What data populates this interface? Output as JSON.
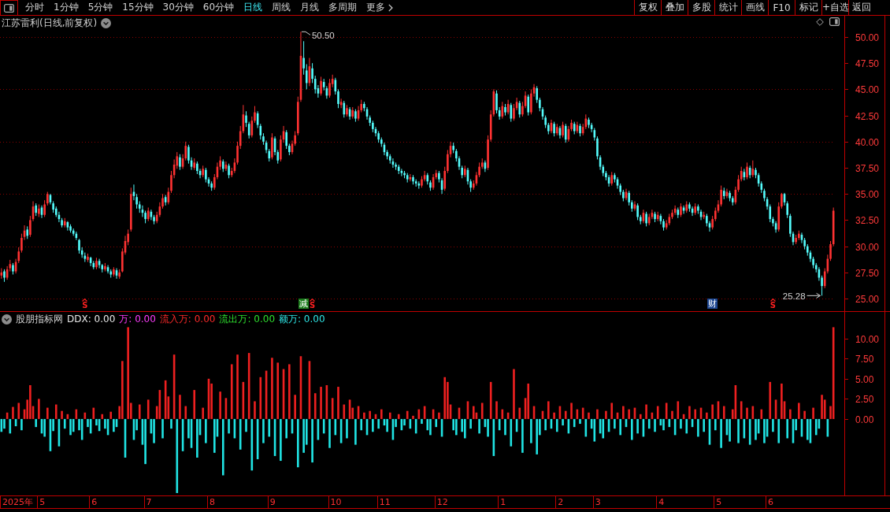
{
  "toolbar": {
    "periods": [
      {
        "label": "分时",
        "selected": false
      },
      {
        "label": "1分钟",
        "selected": false
      },
      {
        "label": "5分钟",
        "selected": false
      },
      {
        "label": "15分钟",
        "selected": false
      },
      {
        "label": "30分钟",
        "selected": false
      },
      {
        "label": "60分钟",
        "selected": false
      },
      {
        "label": "日线",
        "selected": true
      },
      {
        "label": "周线",
        "selected": false
      },
      {
        "label": "月线",
        "selected": false
      },
      {
        "label": "多周期",
        "selected": false
      }
    ],
    "more": "更多",
    "actions": [
      "复权",
      "叠加",
      "多股",
      "统计",
      "画线",
      "F10",
      "标记",
      "+自选",
      "返回"
    ]
  },
  "price_pane": {
    "title": "江苏雷利(日线,前复权)",
    "chart_data": [
      {
        "type": "candlestick",
        "ylim": [
          23.8,
          52.03
        ],
        "yticks": [
          {
            "value": 25,
            "label": "25.00"
          },
          {
            "value": 27.5,
            "label": "27.50"
          },
          {
            "value": 30,
            "label": "30.00"
          },
          {
            "value": 32.5,
            "label": "32.50"
          },
          {
            "value": 35,
            "label": "35.00"
          },
          {
            "value": 37.5,
            "label": "37.50"
          },
          {
            "value": 40,
            "label": "40.00"
          },
          {
            "value": 42.5,
            "label": "42.50"
          },
          {
            "value": 45,
            "label": "45.00"
          },
          {
            "value": 47.5,
            "label": "47.50"
          },
          {
            "value": 50,
            "label": "50.00"
          }
        ],
        "grid": true,
        "annotations": [
          "50.50",
          "25.28"
        ],
        "ohlc": [
          [
            27.2,
            27.9,
            26.9,
            27.5
          ],
          [
            27.6,
            27.8,
            26.6,
            27.0
          ],
          [
            27.0,
            28.1,
            26.8,
            27.8
          ],
          [
            27.9,
            28.7,
            27.6,
            28.3
          ],
          [
            28.2,
            28.4,
            27.3,
            27.6
          ],
          [
            27.6,
            28.8,
            27.4,
            28.5
          ],
          [
            28.6,
            29.9,
            28.4,
            29.5
          ],
          [
            29.6,
            31.2,
            29.4,
            30.8
          ],
          [
            30.9,
            32.0,
            30.6,
            31.5
          ],
          [
            31.6,
            31.9,
            30.7,
            31.0
          ],
          [
            31.1,
            32.9,
            30.9,
            32.5
          ],
          [
            32.6,
            34.3,
            32.4,
            33.8
          ],
          [
            33.9,
            34.1,
            32.9,
            33.2
          ],
          [
            33.1,
            34.0,
            32.8,
            33.6
          ],
          [
            33.7,
            33.9,
            32.7,
            33.0
          ],
          [
            33.0,
            34.4,
            32.8,
            34.0
          ],
          [
            34.1,
            35.2,
            33.9,
            35.0
          ],
          [
            34.9,
            35.0,
            34.0,
            34.2
          ],
          [
            34.1,
            34.3,
            33.2,
            33.5
          ],
          [
            33.6,
            33.8,
            32.8,
            33.0
          ],
          [
            33.0,
            33.3,
            32.3,
            32.6
          ],
          [
            32.5,
            32.7,
            31.8,
            32.0
          ],
          [
            32.0,
            32.7,
            31.8,
            32.4
          ],
          [
            32.3,
            32.4,
            31.5,
            31.8
          ],
          [
            31.9,
            32.1,
            31.3,
            31.5
          ],
          [
            31.5,
            31.7,
            31.0,
            31.2
          ],
          [
            31.2,
            31.4,
            30.6,
            30.8
          ],
          [
            30.6,
            30.7,
            29.3,
            29.6
          ],
          [
            29.6,
            29.9,
            28.9,
            29.2
          ],
          [
            29.1,
            29.4,
            28.5,
            28.8
          ],
          [
            28.7,
            29.3,
            28.5,
            29.0
          ],
          [
            28.9,
            29.0,
            28.1,
            28.4
          ],
          [
            28.4,
            28.6,
            27.8,
            28.0
          ],
          [
            28.0,
            28.9,
            27.8,
            28.6
          ],
          [
            28.6,
            28.8,
            27.9,
            28.2
          ],
          [
            28.2,
            28.3,
            27.5,
            27.8
          ],
          [
            27.8,
            28.4,
            27.6,
            28.1
          ],
          [
            28.0,
            28.2,
            27.4,
            27.6
          ],
          [
            27.6,
            27.8,
            27.0,
            27.3
          ],
          [
            27.3,
            28.0,
            27.1,
            27.8
          ],
          [
            27.7,
            27.9,
            26.9,
            27.2
          ],
          [
            27.1,
            27.8,
            26.9,
            27.5
          ],
          [
            27.6,
            29.8,
            27.5,
            29.5
          ],
          [
            29.4,
            31.0,
            29.2,
            30.5
          ],
          [
            30.4,
            31.6,
            30.1,
            31.2
          ],
          [
            31.6,
            35.6,
            31.4,
            35.0
          ],
          [
            35.2,
            35.9,
            34.4,
            34.8
          ],
          [
            34.7,
            35.0,
            33.6,
            34.0
          ],
          [
            34.0,
            34.3,
            33.2,
            33.6
          ],
          [
            33.5,
            33.9,
            32.8,
            33.2
          ],
          [
            33.2,
            33.4,
            32.2,
            32.6
          ],
          [
            32.6,
            33.7,
            32.4,
            33.4
          ],
          [
            33.3,
            33.5,
            32.5,
            32.8
          ],
          [
            32.8,
            33.0,
            32.1,
            32.4
          ],
          [
            32.4,
            33.3,
            32.2,
            33.0
          ],
          [
            33.0,
            34.2,
            32.8,
            33.8
          ],
          [
            33.8,
            35.0,
            33.6,
            34.6
          ],
          [
            34.7,
            34.9,
            33.9,
            34.2
          ],
          [
            34.2,
            35.6,
            34.0,
            35.2
          ],
          [
            35.3,
            37.2,
            35.1,
            36.8
          ],
          [
            36.8,
            38.3,
            36.5,
            37.8
          ],
          [
            37.7,
            39.0,
            37.4,
            38.6
          ],
          [
            38.5,
            38.8,
            37.3,
            37.6
          ],
          [
            37.6,
            38.8,
            37.4,
            38.4
          ],
          [
            38.4,
            40.0,
            38.2,
            39.6
          ],
          [
            39.5,
            39.7,
            37.9,
            38.2
          ],
          [
            38.2,
            38.5,
            37.3,
            37.6
          ],
          [
            37.5,
            38.4,
            37.3,
            38.0
          ],
          [
            37.9,
            38.1,
            36.9,
            37.2
          ],
          [
            37.2,
            37.4,
            36.5,
            36.8
          ],
          [
            36.8,
            37.7,
            36.6,
            37.4
          ],
          [
            37.3,
            37.5,
            36.1,
            36.4
          ],
          [
            36.4,
            36.6,
            35.7,
            36.0
          ],
          [
            36.0,
            36.2,
            35.3,
            35.6
          ],
          [
            35.6,
            36.9,
            35.4,
            36.6
          ],
          [
            36.6,
            38.0,
            36.4,
            37.6
          ],
          [
            37.6,
            38.6,
            37.3,
            38.2
          ],
          [
            38.1,
            38.3,
            37.1,
            37.4
          ],
          [
            37.4,
            38.1,
            37.2,
            37.8
          ],
          [
            37.7,
            37.9,
            36.5,
            36.8
          ],
          [
            36.8,
            37.5,
            36.6,
            37.2
          ],
          [
            37.2,
            38.4,
            37.0,
            38.0
          ],
          [
            38.0,
            40.0,
            37.8,
            39.6
          ],
          [
            39.6,
            41.5,
            39.3,
            41.0
          ],
          [
            41.0,
            43.5,
            40.8,
            42.6
          ],
          [
            42.5,
            42.9,
            41.4,
            41.8
          ],
          [
            41.7,
            41.9,
            40.3,
            40.6
          ],
          [
            40.6,
            42.4,
            40.4,
            42.0
          ],
          [
            42.0,
            43.4,
            41.8,
            42.8
          ],
          [
            42.7,
            42.9,
            41.3,
            41.6
          ],
          [
            41.5,
            41.7,
            40.2,
            40.6
          ],
          [
            40.5,
            40.8,
            39.7,
            40.0
          ],
          [
            39.9,
            40.1,
            38.9,
            39.2
          ],
          [
            39.1,
            39.3,
            38.1,
            38.4
          ],
          [
            38.5,
            40.8,
            38.3,
            40.4
          ],
          [
            40.3,
            40.5,
            38.7,
            39.0
          ],
          [
            39.0,
            39.2,
            37.9,
            38.2
          ],
          [
            38.3,
            40.6,
            38.1,
            40.2
          ],
          [
            40.2,
            41.5,
            39.9,
            41.0
          ],
          [
            40.9,
            41.1,
            39.3,
            39.6
          ],
          [
            39.6,
            39.8,
            38.7,
            39.0
          ],
          [
            39.0,
            40.1,
            38.8,
            39.8
          ],
          [
            39.8,
            41.0,
            39.6,
            40.6
          ],
          [
            40.8,
            44.3,
            40.6,
            43.8
          ],
          [
            44.0,
            50.5,
            43.8,
            48.2
          ],
          [
            48.0,
            49.6,
            46.4,
            47.0
          ],
          [
            46.8,
            47.4,
            45.0,
            45.6
          ],
          [
            45.6,
            48.0,
            45.3,
            47.2
          ],
          [
            47.0,
            47.5,
            45.6,
            46.0
          ],
          [
            46.0,
            46.3,
            44.6,
            45.0
          ],
          [
            45.1,
            45.4,
            44.2,
            44.6
          ],
          [
            44.6,
            46.2,
            44.4,
            45.8
          ],
          [
            45.7,
            46.0,
            44.9,
            45.2
          ],
          [
            45.1,
            45.3,
            44.1,
            44.4
          ],
          [
            44.4,
            46.0,
            44.2,
            45.6
          ],
          [
            45.5,
            46.4,
            45.2,
            46.0
          ],
          [
            45.9,
            46.1,
            44.5,
            44.8
          ],
          [
            44.8,
            45.0,
            43.2,
            43.6
          ],
          [
            43.5,
            44.1,
            43.2,
            43.8
          ],
          [
            43.7,
            43.9,
            42.3,
            42.6
          ],
          [
            42.6,
            43.5,
            42.4,
            43.2
          ],
          [
            43.1,
            43.3,
            42.1,
            42.4
          ],
          [
            42.4,
            43.3,
            42.2,
            43.0
          ],
          [
            42.9,
            43.1,
            41.9,
            42.2
          ],
          [
            42.2,
            43.4,
            42.0,
            43.0
          ],
          [
            43.0,
            44.0,
            42.8,
            43.6
          ],
          [
            43.6,
            43.8,
            42.9,
            43.2
          ],
          [
            43.1,
            43.3,
            42.1,
            42.4
          ],
          [
            42.3,
            42.5,
            41.5,
            41.8
          ],
          [
            41.8,
            42.0,
            40.9,
            41.2
          ],
          [
            41.2,
            41.4,
            40.5,
            40.8
          ],
          [
            40.8,
            41.0,
            39.9,
            40.2
          ],
          [
            40.2,
            40.4,
            39.5,
            39.8
          ],
          [
            39.7,
            39.9,
            38.7,
            39.0
          ],
          [
            39.0,
            39.2,
            38.3,
            38.6
          ],
          [
            38.6,
            38.8,
            37.9,
            38.2
          ],
          [
            38.1,
            38.4,
            37.5,
            37.8
          ],
          [
            37.8,
            38.0,
            37.3,
            37.6
          ],
          [
            37.6,
            37.8,
            36.9,
            37.2
          ],
          [
            37.2,
            37.4,
            36.7,
            37.0
          ],
          [
            37.0,
            37.2,
            36.5,
            36.8
          ],
          [
            36.8,
            37.0,
            36.1,
            36.4
          ],
          [
            36.4,
            36.9,
            36.2,
            36.6
          ],
          [
            36.6,
            36.8,
            35.9,
            36.2
          ],
          [
            36.2,
            36.4,
            35.7,
            36.0
          ],
          [
            36.0,
            36.2,
            35.5,
            35.8
          ],
          [
            35.8,
            36.7,
            35.6,
            36.4
          ],
          [
            36.4,
            37.2,
            36.2,
            36.8
          ],
          [
            36.8,
            37.0,
            35.9,
            36.2
          ],
          [
            36.1,
            36.3,
            35.3,
            35.6
          ],
          [
            35.6,
            36.9,
            35.4,
            36.6
          ],
          [
            36.6,
            37.3,
            36.4,
            37.0
          ],
          [
            37.0,
            37.2,
            36.1,
            36.4
          ],
          [
            36.3,
            36.5,
            35.0,
            35.4
          ],
          [
            35.5,
            37.6,
            35.3,
            37.2
          ],
          [
            37.2,
            39.2,
            37.0,
            38.8
          ],
          [
            38.8,
            40.0,
            38.5,
            39.6
          ],
          [
            39.6,
            39.9,
            38.9,
            39.2
          ],
          [
            39.1,
            39.3,
            38.1,
            38.4
          ],
          [
            38.4,
            38.6,
            37.3,
            37.6
          ],
          [
            37.5,
            37.7,
            36.5,
            36.8
          ],
          [
            36.8,
            37.7,
            36.6,
            37.4
          ],
          [
            37.3,
            37.5,
            35.9,
            36.2
          ],
          [
            36.2,
            36.4,
            35.2,
            35.6
          ],
          [
            35.6,
            36.3,
            35.4,
            36.0
          ],
          [
            36.0,
            37.1,
            35.8,
            36.8
          ],
          [
            36.8,
            38.0,
            36.6,
            37.6
          ],
          [
            37.6,
            38.4,
            37.4,
            38.0
          ],
          [
            38.0,
            38.2,
            37.1,
            37.4
          ],
          [
            37.5,
            40.6,
            37.3,
            40.2
          ],
          [
            40.2,
            43.0,
            40.0,
            42.6
          ],
          [
            42.6,
            45.0,
            42.4,
            44.8
          ],
          [
            44.6,
            44.9,
            42.7,
            43.0
          ],
          [
            43.0,
            43.3,
            42.1,
            42.4
          ],
          [
            42.4,
            43.8,
            42.2,
            43.4
          ],
          [
            43.3,
            43.6,
            42.5,
            42.8
          ],
          [
            42.8,
            44.0,
            42.6,
            43.6
          ],
          [
            43.5,
            43.7,
            41.9,
            42.2
          ],
          [
            42.2,
            43.6,
            42.0,
            43.2
          ],
          [
            43.2,
            44.2,
            43.0,
            43.8
          ],
          [
            43.7,
            43.9,
            42.3,
            42.6
          ],
          [
            42.6,
            43.8,
            42.4,
            43.4
          ],
          [
            43.4,
            44.8,
            43.2,
            44.4
          ],
          [
            44.3,
            44.5,
            42.5,
            42.8
          ],
          [
            42.8,
            45.0,
            42.6,
            44.6
          ],
          [
            44.6,
            45.5,
            44.3,
            45.2
          ],
          [
            45.1,
            45.3,
            43.7,
            44.0
          ],
          [
            44.0,
            44.2,
            42.9,
            43.2
          ],
          [
            43.1,
            43.3,
            42.1,
            42.4
          ],
          [
            42.3,
            42.5,
            41.3,
            41.6
          ],
          [
            41.6,
            41.8,
            40.7,
            41.0
          ],
          [
            41.0,
            42.1,
            40.8,
            41.8
          ],
          [
            41.7,
            41.9,
            40.5,
            40.8
          ],
          [
            40.8,
            41.7,
            40.6,
            41.4
          ],
          [
            41.3,
            41.5,
            40.3,
            40.6
          ],
          [
            40.6,
            41.9,
            40.4,
            41.6
          ],
          [
            41.5,
            41.7,
            39.9,
            40.2
          ],
          [
            40.2,
            41.5,
            40.0,
            41.2
          ],
          [
            41.2,
            42.1,
            41.0,
            41.8
          ],
          [
            41.7,
            41.9,
            40.7,
            41.0
          ],
          [
            41.0,
            41.9,
            40.8,
            41.6
          ],
          [
            41.5,
            41.7,
            40.5,
            40.8
          ],
          [
            40.8,
            41.7,
            40.6,
            41.4
          ],
          [
            41.4,
            42.6,
            41.2,
            42.2
          ],
          [
            42.1,
            42.3,
            41.3,
            41.6
          ],
          [
            41.6,
            41.8,
            40.9,
            41.2
          ],
          [
            41.1,
            41.3,
            40.1,
            40.4
          ],
          [
            40.3,
            40.5,
            38.3,
            38.6
          ],
          [
            38.5,
            38.7,
            37.3,
            37.6
          ],
          [
            37.6,
            37.8,
            36.7,
            37.0
          ],
          [
            37.0,
            37.2,
            36.3,
            36.6
          ],
          [
            36.6,
            36.8,
            35.7,
            36.0
          ],
          [
            36.0,
            37.1,
            35.8,
            36.8
          ],
          [
            36.8,
            37.0,
            36.1,
            36.4
          ],
          [
            36.4,
            36.6,
            35.5,
            35.8
          ],
          [
            35.8,
            36.0,
            34.9,
            35.2
          ],
          [
            35.2,
            35.4,
            34.3,
            34.6
          ],
          [
            34.6,
            35.5,
            34.4,
            35.2
          ],
          [
            35.1,
            35.3,
            33.9,
            34.2
          ],
          [
            34.2,
            34.4,
            33.3,
            33.6
          ],
          [
            33.6,
            34.3,
            33.4,
            34.0
          ],
          [
            33.9,
            34.1,
            32.5,
            32.8
          ],
          [
            32.8,
            33.0,
            32.1,
            32.4
          ],
          [
            32.4,
            33.5,
            32.2,
            33.2
          ],
          [
            33.1,
            33.3,
            31.9,
            32.2
          ],
          [
            32.2,
            33.1,
            32.0,
            32.8
          ],
          [
            32.8,
            33.5,
            32.6,
            33.2
          ],
          [
            33.1,
            33.3,
            32.3,
            32.6
          ],
          [
            32.6,
            33.3,
            32.4,
            33.0
          ],
          [
            32.9,
            33.1,
            32.1,
            32.4
          ],
          [
            32.4,
            32.6,
            31.5,
            31.8
          ],
          [
            31.8,
            32.5,
            31.6,
            32.2
          ],
          [
            32.2,
            33.1,
            32.0,
            32.8
          ],
          [
            32.8,
            33.5,
            32.6,
            33.2
          ],
          [
            33.2,
            33.9,
            33.0,
            33.6
          ],
          [
            33.5,
            33.7,
            32.7,
            33.0
          ],
          [
            33.0,
            34.1,
            32.8,
            33.8
          ],
          [
            33.7,
            33.9,
            33.1,
            33.4
          ],
          [
            33.4,
            34.3,
            33.2,
            34.0
          ],
          [
            34.0,
            34.2,
            33.3,
            33.6
          ],
          [
            33.6,
            33.8,
            32.9,
            33.2
          ],
          [
            33.2,
            34.1,
            33.0,
            33.8
          ],
          [
            33.8,
            34.0,
            33.1,
            33.4
          ],
          [
            33.3,
            33.5,
            32.5,
            32.8
          ],
          [
            32.8,
            33.3,
            32.6,
            33.0
          ],
          [
            32.9,
            33.1,
            31.9,
            32.2
          ],
          [
            32.2,
            32.4,
            31.4,
            31.8
          ],
          [
            31.8,
            32.9,
            31.6,
            32.6
          ],
          [
            32.6,
            33.7,
            32.4,
            33.4
          ],
          [
            33.4,
            34.4,
            33.2,
            34.0
          ],
          [
            34.0,
            35.8,
            33.8,
            35.4
          ],
          [
            35.3,
            35.6,
            34.5,
            34.8
          ],
          [
            34.8,
            35.5,
            34.6,
            35.2
          ],
          [
            35.1,
            35.3,
            34.3,
            34.6
          ],
          [
            34.6,
            34.8,
            33.9,
            34.2
          ],
          [
            34.2,
            35.7,
            34.0,
            35.4
          ],
          [
            35.4,
            36.8,
            35.2,
            36.4
          ],
          [
            36.4,
            37.6,
            36.2,
            37.2
          ],
          [
            37.1,
            37.4,
            36.3,
            36.6
          ],
          [
            36.6,
            38.0,
            36.4,
            37.6
          ],
          [
            37.5,
            37.7,
            36.5,
            36.8
          ],
          [
            36.8,
            38.2,
            36.6,
            37.4
          ],
          [
            37.3,
            37.5,
            36.5,
            36.8
          ],
          [
            36.8,
            37.0,
            35.7,
            36.0
          ],
          [
            36.0,
            36.2,
            35.1,
            35.4
          ],
          [
            35.3,
            35.5,
            34.3,
            34.6
          ],
          [
            34.5,
            34.7,
            33.5,
            33.8
          ],
          [
            33.8,
            34.0,
            32.3,
            32.6
          ],
          [
            32.6,
            32.8,
            31.9,
            32.2
          ],
          [
            32.2,
            32.4,
            31.3,
            31.6
          ],
          [
            31.6,
            34.2,
            31.4,
            33.8
          ],
          [
            33.8,
            35.1,
            33.6,
            35.0
          ],
          [
            35.0,
            35.1,
            33.9,
            34.2
          ],
          [
            34.1,
            34.3,
            32.7,
            33.0
          ],
          [
            32.9,
            33.1,
            30.9,
            31.2
          ],
          [
            31.2,
            31.4,
            30.1,
            30.4
          ],
          [
            30.4,
            31.1,
            30.2,
            30.8
          ],
          [
            30.8,
            31.5,
            30.6,
            31.2
          ],
          [
            31.1,
            31.3,
            30.3,
            30.6
          ],
          [
            30.6,
            30.8,
            29.7,
            30.0
          ],
          [
            30.0,
            30.2,
            29.1,
            29.4
          ],
          [
            29.4,
            29.6,
            28.5,
            28.8
          ],
          [
            28.8,
            29.0,
            27.9,
            28.2
          ],
          [
            28.2,
            28.4,
            27.5,
            27.8
          ],
          [
            27.8,
            28.0,
            26.7,
            27.0
          ],
          [
            27.0,
            27.2,
            25.28,
            26.2
          ],
          [
            26.2,
            27.9,
            26.0,
            27.6
          ],
          [
            27.6,
            29.2,
            27.4,
            28.8
          ],
          [
            28.8,
            30.5,
            28.6,
            30.2
          ],
          [
            30.2,
            33.7,
            30.0,
            33.4
          ]
        ]
      }
    ],
    "events": [
      {
        "kind": "signal",
        "label": "S"
      },
      {
        "kind": "badge",
        "label": "减",
        "color": "#1c7c1c"
      },
      {
        "kind": "signal",
        "label": "S"
      },
      {
        "kind": "badge",
        "label": "财",
        "color": "#1d4690"
      },
      {
        "kind": "signal",
        "label": "S"
      }
    ]
  },
  "indicator_pane": {
    "name": "股朋指标网",
    "readouts": [
      {
        "text": "DDX: 0.00",
        "color": "#e8e8e8"
      },
      {
        "text": "万: 0.00",
        "color": "#ff3cff"
      },
      {
        "text": "流入万: 0.00",
        "color": "#ff2a2a"
      },
      {
        "text": "流出万: 0.00",
        "color": "#2ee02e"
      },
      {
        "text": "额万: 0.00",
        "color": "#2ee6e6"
      }
    ],
    "chart_data": [
      {
        "type": "bar",
        "ylim": [
          -9.5,
          13.3
        ],
        "yticks": [
          {
            "value": 0,
            "label": "0.00"
          },
          {
            "value": 2.5,
            "label": "2.50"
          },
          {
            "value": 5,
            "label": "5.00"
          },
          {
            "value": 7.5,
            "label": "7.50"
          },
          {
            "value": 10,
            "label": "10.00"
          }
        ],
        "values": [
          -1.6,
          -1.2,
          0.8,
          -1.8,
          1.5,
          -0.9,
          2.0,
          -1.4,
          1.2,
          2.4,
          4.2,
          1.6,
          -1.0,
          2.5,
          -1.8,
          -2.2,
          1.4,
          -4.0,
          -1.5,
          1.8,
          -3.4,
          1.0,
          -1.2,
          0.6,
          -2.0,
          -1.6,
          1.2,
          -1.4,
          -2.6,
          0.8,
          -1.0,
          -1.8,
          1.4,
          -0.8,
          -1.5,
          0.6,
          -1.2,
          -2.0,
          0.9,
          -1.6,
          -1.0,
          1.6,
          7.2,
          -4.8,
          11.4,
          2.0,
          -2.6,
          -1.4,
          1.8,
          -3.2,
          -5.6,
          2.4,
          -1.8,
          -3.0,
          1.6,
          3.6,
          -2.4,
          4.8,
          2.8,
          -1.2,
          8.0,
          -9.2,
          3.0,
          -4.0,
          1.6,
          -2.4,
          -3.6,
          3.6,
          -4.8,
          -2.0,
          1.4,
          -3.0,
          5.0,
          4.4,
          -4.2,
          -2.2,
          3.4,
          -7.0,
          2.6,
          -1.8,
          6.8,
          -2.4,
          8.0,
          -3.8,
          4.6,
          -1.6,
          8.2,
          -6.4,
          2.2,
          -5.0,
          5.2,
          -3.0,
          6.0,
          -2.2,
          7.6,
          -4.6,
          7.0,
          -5.2,
          6.2,
          -2.4,
          6.8,
          -1.8,
          3.0,
          -6.0,
          7.8,
          -4.2,
          -3.2,
          7.2,
          -5.4,
          3.2,
          -2.6,
          4.0,
          -1.8,
          4.2,
          -3.6,
          2.6,
          -2.0,
          4.0,
          -3.0,
          1.8,
          -2.4,
          2.4,
          1.4,
          -3.2,
          1.6,
          -1.4,
          0.8,
          -2.0,
          1.0,
          -1.6,
          0.6,
          -1.2,
          1.2,
          -0.8,
          -1.6,
          0.8,
          -2.6,
          -1.0,
          0.6,
          -1.4,
          -0.8,
          1.0,
          -1.2,
          0.4,
          -1.8,
          1.2,
          -0.6,
          1.6,
          -1.4,
          -2.0,
          1.2,
          -1.0,
          0.8,
          -2.2,
          5.2,
          4.6,
          1.8,
          -1.4,
          -2.0,
          1.4,
          -1.6,
          -2.4,
          2.2,
          -1.2,
          1.6,
          0.8,
          -1.8,
          2.0,
          -1.0,
          -2.2,
          4.6,
          -4.6,
          2.2,
          -1.4,
          1.2,
          -2.0,
          0.8,
          -3.4,
          6.2,
          -1.6,
          1.4,
          -4.2,
          2.6,
          4.4,
          -3.0,
          1.6,
          -4.4,
          -2.0,
          1.0,
          -1.4,
          2.2,
          -1.2,
          0.8,
          -1.6,
          1.6,
          -0.8,
          1.0,
          -1.8,
          2.0,
          -1.0,
          1.2,
          -0.6,
          1.4,
          -2.2,
          0.8,
          -1.2,
          -2.8,
          1.2,
          -1.8,
          -2.4,
          1.0,
          -1.6,
          2.0,
          -1.2,
          0.8,
          -2.0,
          1.6,
          -1.0,
          1.2,
          -2.6,
          1.4,
          -1.8,
          0.6,
          -2.2,
          1.8,
          -1.2,
          0.8,
          -1.6,
          1.6,
          -0.8,
          -1.4,
          2.0,
          -1.0,
          1.0,
          -2.0,
          2.2,
          -1.2,
          0.6,
          -1.8,
          1.6,
          -1.0,
          1.2,
          -2.2,
          1.4,
          -1.6,
          0.8,
          -3.2,
          1.8,
          -1.4,
          2.2,
          -3.6,
          1.6,
          -2.0,
          -2.8,
          1.2,
          4.2,
          -3.0,
          2.2,
          -2.4,
          1.4,
          -3.2,
          1.6,
          -2.6,
          -1.8,
          1.2,
          -3.0,
          -2.2,
          4.6,
          -1.6,
          2.4,
          -3.0,
          4.4,
          2.2,
          -2.4,
          1.2,
          -3.0,
          -1.4,
          2.0,
          -2.2,
          1.0,
          -2.6,
          -3.0,
          1.4,
          -2.0,
          -1.2,
          3.0,
          2.4,
          -2.2,
          1.6,
          11.4
        ]
      }
    ]
  },
  "time_axis": [
    "2025年",
    "5",
    "6",
    "7",
    "8",
    "9",
    "10",
    "11",
    "12",
    "1",
    "2",
    "3",
    "4",
    "5",
    "6"
  ]
}
